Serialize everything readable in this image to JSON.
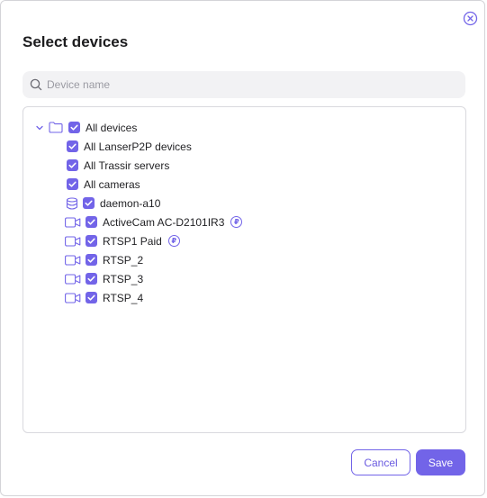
{
  "dialog": {
    "title": "Select devices",
    "search": {
      "placeholder": "Device name",
      "value": ""
    },
    "tree": {
      "root": {
        "label": "All devices",
        "checked": true,
        "expanded": true,
        "icon": "folder-icon"
      },
      "groups": [
        {
          "label": "All LanserP2P devices",
          "checked": true
        },
        {
          "label": "All Trassir servers",
          "checked": true
        },
        {
          "label": "All cameras",
          "checked": true
        }
      ],
      "server": {
        "label": "daemon-a10",
        "checked": true,
        "icon": "database-icon"
      },
      "cameras": [
        {
          "label": "ActiveCam AC-D2101IR3",
          "checked": true,
          "paid": true,
          "badge": "₽"
        },
        {
          "label": "RTSP1 Paid",
          "checked": true,
          "paid": true,
          "badge": "₽"
        },
        {
          "label": "RTSP_2",
          "checked": true,
          "paid": false
        },
        {
          "label": "RTSP_3",
          "checked": true,
          "paid": false
        },
        {
          "label": "RTSP_4",
          "checked": true,
          "paid": false
        }
      ]
    },
    "buttons": {
      "cancel": "Cancel",
      "save": "Save"
    }
  },
  "colors": {
    "accent": "#7264e8",
    "border": "#d9d9de",
    "search_bg": "#f2f2f4"
  }
}
